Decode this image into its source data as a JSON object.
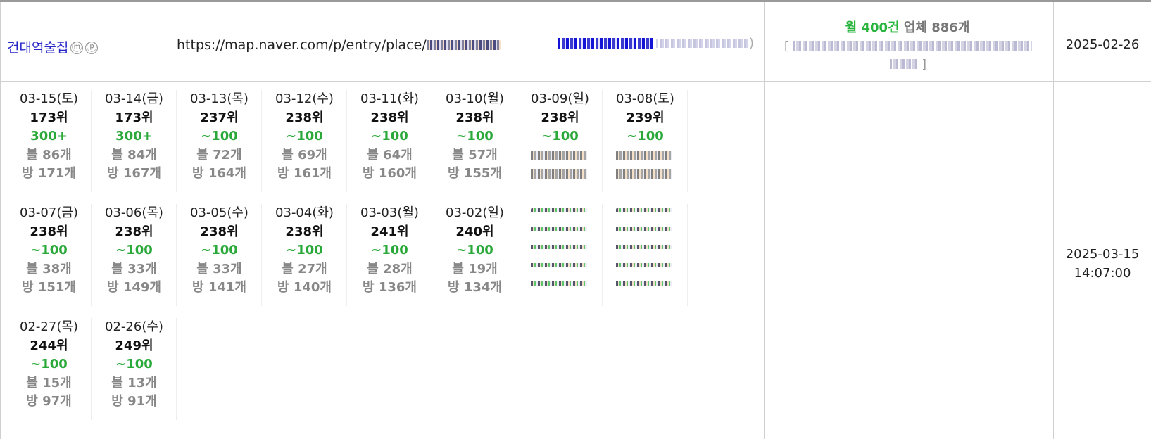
{
  "row": {
    "shop_name": "건대역술집",
    "shop_badges": [
      "ⓜ",
      "ⓟ"
    ],
    "url_prefix": "https://map.naver.com/p/entry/place/",
    "monthly_label_prefix": "월",
    "monthly_count": "400건",
    "business_count_label": "업체 886개",
    "registered_date": "2025-02-26",
    "checked_date": "2025-03-15",
    "checked_time": "14:07:00"
  },
  "days": [
    {
      "date": "03-15(토)",
      "rank": "173위",
      "volume": "300+",
      "blog": "블 86개",
      "place": "방 171개"
    },
    {
      "date": "03-14(금)",
      "rank": "173위",
      "volume": "300+",
      "blog": "블 84개",
      "place": "방 167개"
    },
    {
      "date": "03-13(목)",
      "rank": "237위",
      "volume": "~100",
      "blog": "블 72개",
      "place": "방 164개"
    },
    {
      "date": "03-12(수)",
      "rank": "238위",
      "volume": "~100",
      "blog": "블 69개",
      "place": "방 161개"
    },
    {
      "date": "03-11(화)",
      "rank": "238위",
      "volume": "~100",
      "blog": "블 64개",
      "place": "방 160개"
    },
    {
      "date": "03-10(월)",
      "rank": "238위",
      "volume": "~100",
      "blog": "블 57개",
      "place": "방 155개"
    },
    {
      "date": "03-09(일)",
      "rank": "238위",
      "volume": "~100",
      "blog": "",
      "place": ""
    },
    {
      "date": "03-08(토)",
      "rank": "239위",
      "volume": "~100",
      "blog": "",
      "place": ""
    },
    {
      "date": "03-07(금)",
      "rank": "238위",
      "volume": "~100",
      "blog": "블 38개",
      "place": "방 151개"
    },
    {
      "date": "03-06(목)",
      "rank": "238위",
      "volume": "~100",
      "blog": "블 33개",
      "place": "방 149개"
    },
    {
      "date": "03-05(수)",
      "rank": "238위",
      "volume": "~100",
      "blog": "블 33개",
      "place": "방 141개"
    },
    {
      "date": "03-04(화)",
      "rank": "238위",
      "volume": "~100",
      "blog": "블 27개",
      "place": "방 140개"
    },
    {
      "date": "03-03(월)",
      "rank": "241위",
      "volume": "~100",
      "blog": "블 28개",
      "place": "방 136개"
    },
    {
      "date": "03-02(일)",
      "rank": "240위",
      "volume": "~100",
      "blog": "블 19개",
      "place": "방 134개"
    },
    {
      "date": "",
      "rank": "",
      "volume": "",
      "blog": "",
      "place": ""
    },
    {
      "date": "",
      "rank": "",
      "volume": "",
      "blog": "",
      "place": ""
    },
    {
      "date": "02-27(목)",
      "rank": "244위",
      "volume": "~100",
      "blog": "블 15개",
      "place": "방 97개"
    },
    {
      "date": "02-26(수)",
      "rank": "249위",
      "volume": "~100",
      "blog": "블 13개",
      "place": "방 91개"
    }
  ]
}
